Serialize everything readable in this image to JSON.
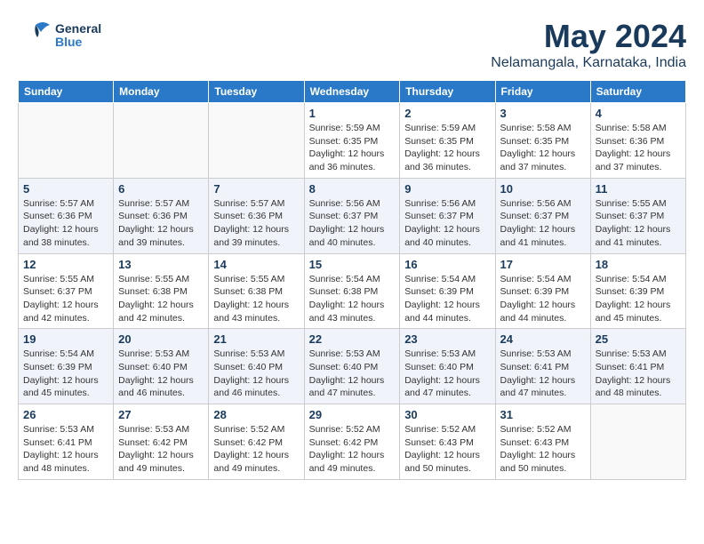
{
  "header": {
    "logo_line1": "General",
    "logo_line2": "Blue",
    "month": "May 2024",
    "location": "Nelamangala, Karnataka, India"
  },
  "weekdays": [
    "Sunday",
    "Monday",
    "Tuesday",
    "Wednesday",
    "Thursday",
    "Friday",
    "Saturday"
  ],
  "weeks": [
    [
      {
        "day": "",
        "info": ""
      },
      {
        "day": "",
        "info": ""
      },
      {
        "day": "",
        "info": ""
      },
      {
        "day": "1",
        "info": "Sunrise: 5:59 AM\nSunset: 6:35 PM\nDaylight: 12 hours\nand 36 minutes."
      },
      {
        "day": "2",
        "info": "Sunrise: 5:59 AM\nSunset: 6:35 PM\nDaylight: 12 hours\nand 36 minutes."
      },
      {
        "day": "3",
        "info": "Sunrise: 5:58 AM\nSunset: 6:35 PM\nDaylight: 12 hours\nand 37 minutes."
      },
      {
        "day": "4",
        "info": "Sunrise: 5:58 AM\nSunset: 6:36 PM\nDaylight: 12 hours\nand 37 minutes."
      }
    ],
    [
      {
        "day": "5",
        "info": "Sunrise: 5:57 AM\nSunset: 6:36 PM\nDaylight: 12 hours\nand 38 minutes."
      },
      {
        "day": "6",
        "info": "Sunrise: 5:57 AM\nSunset: 6:36 PM\nDaylight: 12 hours\nand 39 minutes."
      },
      {
        "day": "7",
        "info": "Sunrise: 5:57 AM\nSunset: 6:36 PM\nDaylight: 12 hours\nand 39 minutes."
      },
      {
        "day": "8",
        "info": "Sunrise: 5:56 AM\nSunset: 6:37 PM\nDaylight: 12 hours\nand 40 minutes."
      },
      {
        "day": "9",
        "info": "Sunrise: 5:56 AM\nSunset: 6:37 PM\nDaylight: 12 hours\nand 40 minutes."
      },
      {
        "day": "10",
        "info": "Sunrise: 5:56 AM\nSunset: 6:37 PM\nDaylight: 12 hours\nand 41 minutes."
      },
      {
        "day": "11",
        "info": "Sunrise: 5:55 AM\nSunset: 6:37 PM\nDaylight: 12 hours\nand 41 minutes."
      }
    ],
    [
      {
        "day": "12",
        "info": "Sunrise: 5:55 AM\nSunset: 6:37 PM\nDaylight: 12 hours\nand 42 minutes."
      },
      {
        "day": "13",
        "info": "Sunrise: 5:55 AM\nSunset: 6:38 PM\nDaylight: 12 hours\nand 42 minutes."
      },
      {
        "day": "14",
        "info": "Sunrise: 5:55 AM\nSunset: 6:38 PM\nDaylight: 12 hours\nand 43 minutes."
      },
      {
        "day": "15",
        "info": "Sunrise: 5:54 AM\nSunset: 6:38 PM\nDaylight: 12 hours\nand 43 minutes."
      },
      {
        "day": "16",
        "info": "Sunrise: 5:54 AM\nSunset: 6:39 PM\nDaylight: 12 hours\nand 44 minutes."
      },
      {
        "day": "17",
        "info": "Sunrise: 5:54 AM\nSunset: 6:39 PM\nDaylight: 12 hours\nand 44 minutes."
      },
      {
        "day": "18",
        "info": "Sunrise: 5:54 AM\nSunset: 6:39 PM\nDaylight: 12 hours\nand 45 minutes."
      }
    ],
    [
      {
        "day": "19",
        "info": "Sunrise: 5:54 AM\nSunset: 6:39 PM\nDaylight: 12 hours\nand 45 minutes."
      },
      {
        "day": "20",
        "info": "Sunrise: 5:53 AM\nSunset: 6:40 PM\nDaylight: 12 hours\nand 46 minutes."
      },
      {
        "day": "21",
        "info": "Sunrise: 5:53 AM\nSunset: 6:40 PM\nDaylight: 12 hours\nand 46 minutes."
      },
      {
        "day": "22",
        "info": "Sunrise: 5:53 AM\nSunset: 6:40 PM\nDaylight: 12 hours\nand 47 minutes."
      },
      {
        "day": "23",
        "info": "Sunrise: 5:53 AM\nSunset: 6:40 PM\nDaylight: 12 hours\nand 47 minutes."
      },
      {
        "day": "24",
        "info": "Sunrise: 5:53 AM\nSunset: 6:41 PM\nDaylight: 12 hours\nand 47 minutes."
      },
      {
        "day": "25",
        "info": "Sunrise: 5:53 AM\nSunset: 6:41 PM\nDaylight: 12 hours\nand 48 minutes."
      }
    ],
    [
      {
        "day": "26",
        "info": "Sunrise: 5:53 AM\nSunset: 6:41 PM\nDaylight: 12 hours\nand 48 minutes."
      },
      {
        "day": "27",
        "info": "Sunrise: 5:53 AM\nSunset: 6:42 PM\nDaylight: 12 hours\nand 49 minutes."
      },
      {
        "day": "28",
        "info": "Sunrise: 5:52 AM\nSunset: 6:42 PM\nDaylight: 12 hours\nand 49 minutes."
      },
      {
        "day": "29",
        "info": "Sunrise: 5:52 AM\nSunset: 6:42 PM\nDaylight: 12 hours\nand 49 minutes."
      },
      {
        "day": "30",
        "info": "Sunrise: 5:52 AM\nSunset: 6:43 PM\nDaylight: 12 hours\nand 50 minutes."
      },
      {
        "day": "31",
        "info": "Sunrise: 5:52 AM\nSunset: 6:43 PM\nDaylight: 12 hours\nand 50 minutes."
      },
      {
        "day": "",
        "info": ""
      }
    ]
  ]
}
